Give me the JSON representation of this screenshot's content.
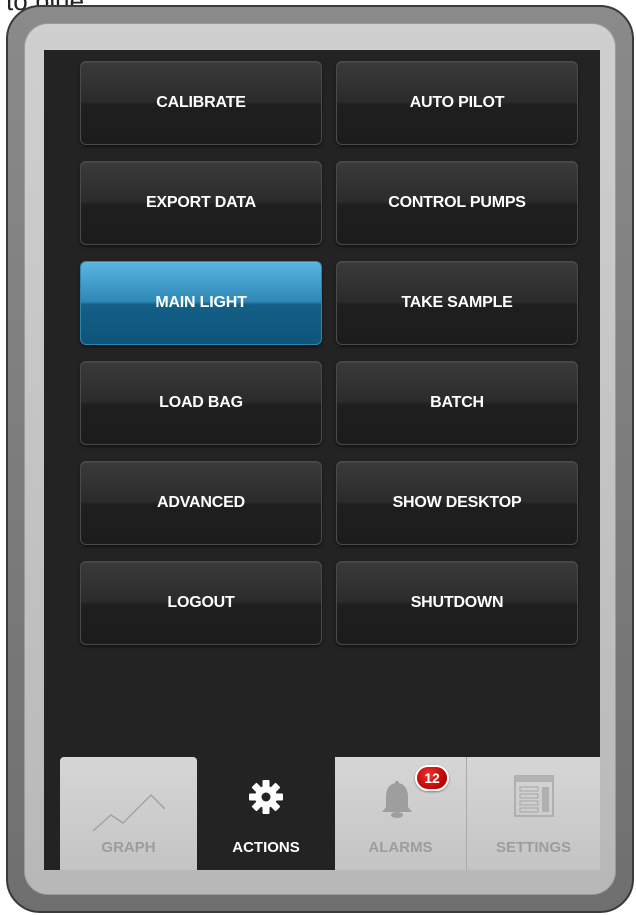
{
  "caption": "to blue.",
  "buttons": [
    {
      "label": "CALIBRATE",
      "active": false
    },
    {
      "label": "AUTO PILOT",
      "active": false
    },
    {
      "label": "EXPORT DATA",
      "active": false
    },
    {
      "label": "CONTROL PUMPS",
      "active": false
    },
    {
      "label": "MAIN LIGHT",
      "active": true
    },
    {
      "label": "TAKE SAMPLE",
      "active": false
    },
    {
      "label": "LOAD BAG",
      "active": false
    },
    {
      "label": "BATCH",
      "active": false
    },
    {
      "label": "ADVANCED",
      "active": false
    },
    {
      "label": "SHOW DESKTOP",
      "active": false
    },
    {
      "label": "LOGOUT",
      "active": false
    },
    {
      "label": "SHUTDOWN",
      "active": false
    }
  ],
  "tabs": {
    "graph": {
      "label": "GRAPH",
      "icon": "line-graph-icon"
    },
    "actions": {
      "label": "ACTIONS",
      "icon": "gear-icon",
      "selected": true
    },
    "alarms": {
      "label": "ALARMS",
      "icon": "bell-icon",
      "badge": "12"
    },
    "settings": {
      "label": "SETTINGS",
      "icon": "settings-list-icon"
    }
  },
  "colors": {
    "active_button": "#2f88b6",
    "screen_background": "#232323",
    "badge": "#cc1111"
  }
}
